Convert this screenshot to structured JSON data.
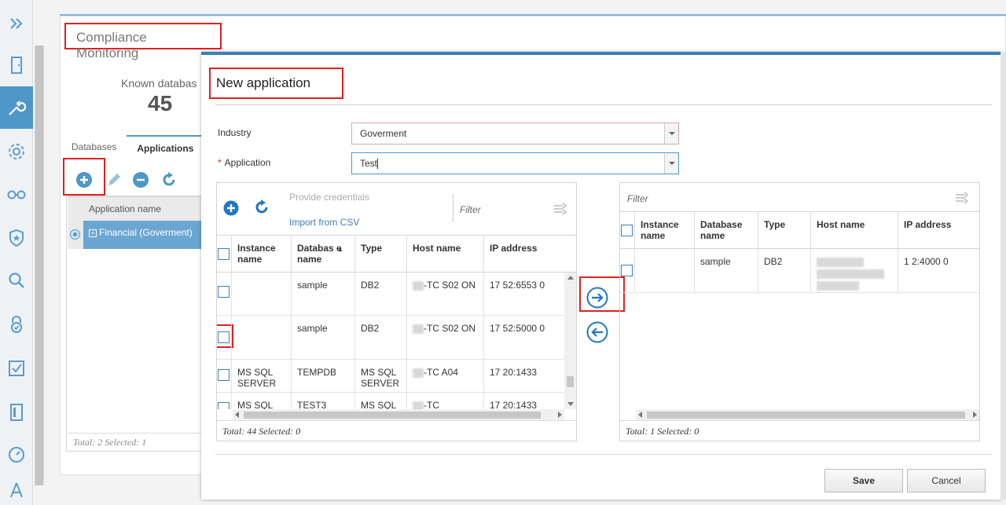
{
  "nav": {
    "items": [
      "expand-icon",
      "door-icon",
      "wrench-icon",
      "gear-icon",
      "glasses-icon",
      "shield-icon",
      "search-icon",
      "lock-icon",
      "checklist-icon",
      "report-icon",
      "gauge-icon",
      "compass-icon"
    ]
  },
  "page": {
    "title": "Compliance Monitoring",
    "known_label": "Known databas",
    "known_value": "45",
    "tabs": [
      "Databases",
      "Applications"
    ],
    "table_header": "Application name",
    "row_label": "Financial (Goverment)",
    "footer": "Total: 2 Selected: 1"
  },
  "modal": {
    "title": "New application",
    "industry_label": "Industry",
    "industry_value": "Goverment",
    "application_required": "*",
    "application_label": "Application",
    "application_value": "Test"
  },
  "left_grid": {
    "provide_credentials": "Provide credentials",
    "import_csv": "Import from CSV",
    "filter_placeholder": "Filter",
    "columns": [
      "Instance name",
      "Databas e name",
      "Type",
      "Host name",
      "IP address"
    ],
    "sort_indicator": "▲",
    "rows": [
      {
        "instance": "",
        "database": "sample",
        "type": "DB2",
        "host": "-TC S02 ON",
        "ip": "17 52:6553 0"
      },
      {
        "instance": "",
        "database": "sample",
        "type": "DB2",
        "host": "-TC S02 ON",
        "ip": "17 52:5000 0"
      },
      {
        "instance": "MS SQL SERVER",
        "database": "TEMPDB",
        "type": "MS SQL SERVER",
        "host": "-TC A04",
        "ip": "17 20:1433"
      },
      {
        "instance": "MS SQL",
        "database": "TEST3",
        "type": "MS SQL",
        "host": "-TC",
        "ip": "17 20:1433"
      }
    ],
    "footer": "Total: 44 Selected: 0"
  },
  "right_grid": {
    "filter_placeholder": "Filter",
    "columns": [
      "Instance name",
      "Database name",
      "Type",
      "Host name",
      "IP address"
    ],
    "rows": [
      {
        "instance": "",
        "database": "sample",
        "type": "DB2",
        "host": "",
        "ip": "1 2:4000 0"
      }
    ],
    "footer": "Total: 1 Selected: 0"
  },
  "buttons": {
    "save": "Save",
    "cancel": "Cancel"
  },
  "colors": {
    "accent": "#3f7fb4",
    "rail_active": "#4f97c6",
    "highlight_box": "#e02020"
  }
}
